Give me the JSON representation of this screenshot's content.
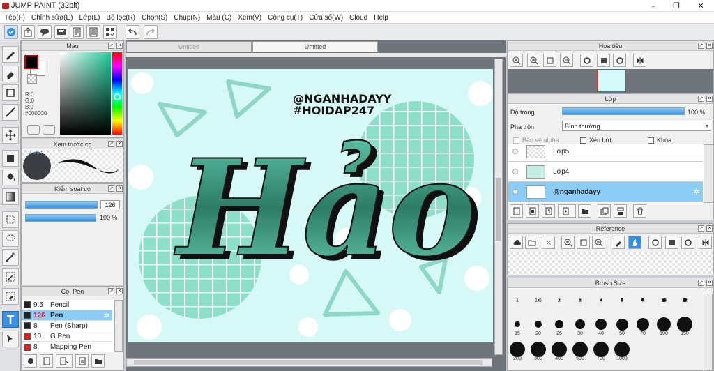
{
  "app": {
    "title": "JUMP PAINT (32bit)"
  },
  "menu": [
    "Tệp(F)",
    "Chỉnh sửa(E)",
    "Lớp(L)",
    "Bộ lọc(R)",
    "Chọn(S)",
    "Chụp(N)",
    "Màu (C)",
    "Xem(V)",
    "Công cụ(T)",
    "Cửa sổ(W)",
    "Cloud",
    "Help"
  ],
  "tabs": [
    "Untitled",
    "Untitled"
  ],
  "color_panel": {
    "title": "Màu",
    "r": "R:0",
    "g": "G:0",
    "b": "B:0",
    "hex": "#000000",
    "fg": "#000000",
    "bg": "#ffffff"
  },
  "brush_preview": {
    "title": "Xem trước cọ",
    "size_label": "2.0mm"
  },
  "brush_control": {
    "title": "Kiểm soát cọ",
    "size_value": "126",
    "opacity_value": "100 %"
  },
  "brush_list": {
    "title": "Cọ: Pen",
    "items": [
      {
        "size": "9.5",
        "name": "Pencil",
        "color": "#222222",
        "selected": false
      },
      {
        "size": "126",
        "name": "Pen",
        "color": "#222222",
        "selected": true
      },
      {
        "size": "8",
        "name": "Pen (Sharp)",
        "color": "#222222",
        "selected": false
      },
      {
        "size": "10",
        "name": "G Pen",
        "color": "#e02020",
        "selected": false
      },
      {
        "size": "8",
        "name": "Mapping Pen",
        "color": "#e02020",
        "selected": false
      }
    ]
  },
  "navigator": {
    "title": "Hoa tiêu"
  },
  "layers": {
    "title": "Lớp",
    "opacity_label": "Độ trong",
    "opacity_value": "100 %",
    "blend_label": "Pha trộn",
    "blend_value": "Bình thường",
    "protect_alpha": "Bảo vệ alpha",
    "clipping": "Xén bớt",
    "lock": "Khóa",
    "items": [
      {
        "name": "Lớp5",
        "selected": false
      },
      {
        "name": "Lớp4",
        "selected": false
      },
      {
        "name": "@nganhadayy",
        "selected": true
      }
    ]
  },
  "reference": {
    "title": "Reference"
  },
  "brush_size": {
    "title": "Brush Size",
    "sizes": [
      "1",
      "1.5",
      "2",
      "3",
      "4",
      "5",
      "7",
      "10",
      "12",
      "15",
      "20",
      "25",
      "30",
      "40",
      "50",
      "70",
      "100",
      "150",
      "200",
      "300",
      "400",
      "500",
      "700",
      "1000"
    ]
  },
  "artwork": {
    "tag1": "@NGANHADAYY",
    "tag2": "#HOIDAP247",
    "word": "Hảo"
  },
  "colors": {
    "accent": "#3b8fe0",
    "teal": "#4aa88f",
    "canvas_bg": "#d6f8f7"
  }
}
